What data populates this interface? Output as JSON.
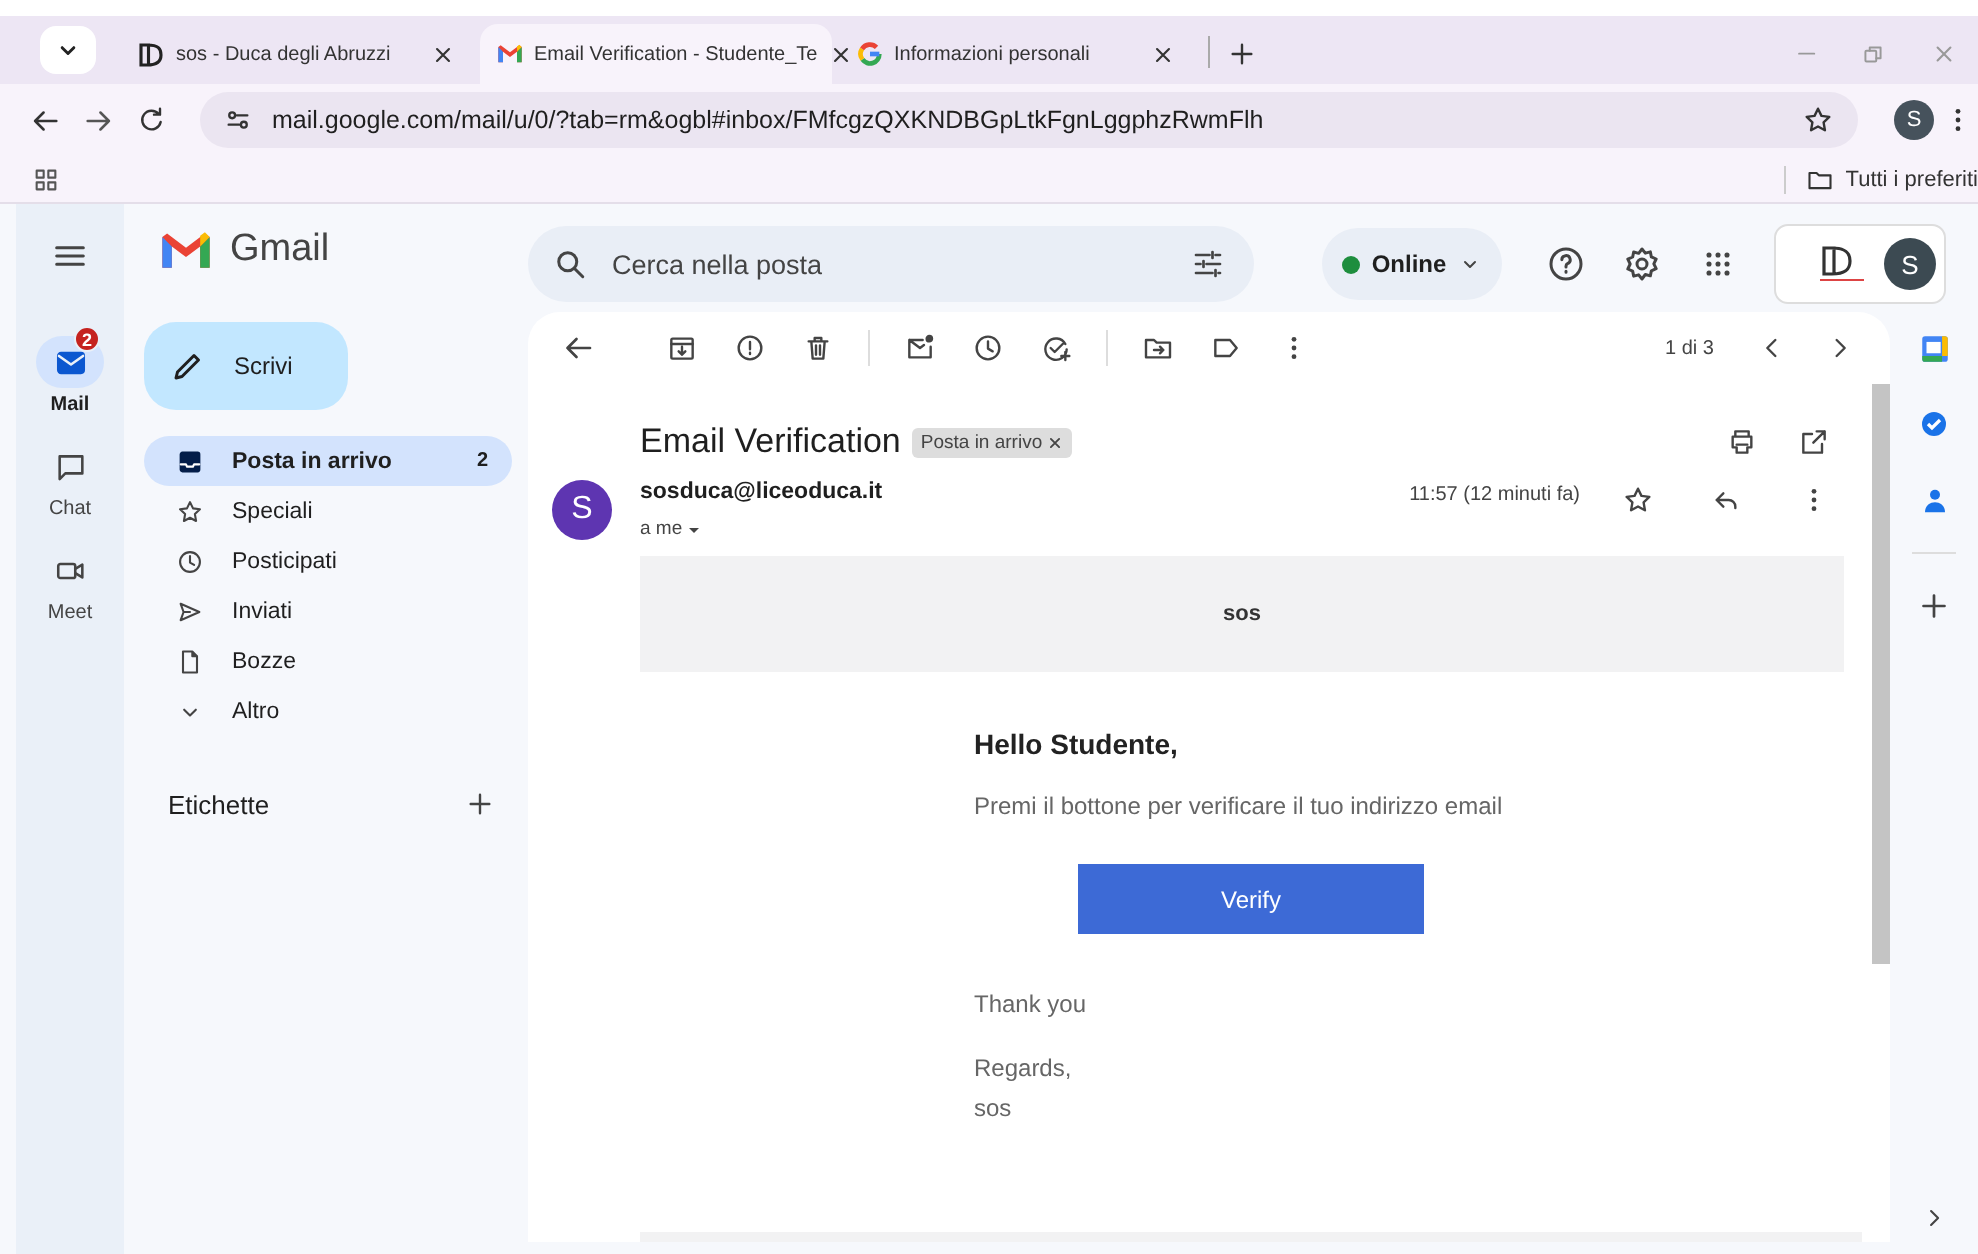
{
  "browser": {
    "tabs": [
      {
        "title": "sos - Duca degli Abruzzi",
        "selected": false
      },
      {
        "title": "Email Verification - Studente_Te",
        "selected": true
      },
      {
        "title": "Informazioni personali",
        "selected": false
      }
    ],
    "url": "mail.google.com/mail/u/0/?tab=rm&ogbl#inbox/FMfcgzQXKNDBGpLtkFgnLggphzRwmFlh",
    "profile_initial": "S",
    "bookmarks_folder": "Tutti i preferiti"
  },
  "rail": [
    {
      "label": "Mail",
      "badge": "2",
      "selected": true
    },
    {
      "label": "Chat",
      "selected": false
    },
    {
      "label": "Meet",
      "selected": false
    }
  ],
  "app_name": "Gmail",
  "compose": "Scrivi",
  "folders": [
    {
      "label": "Posta in arrivo",
      "count": "2",
      "selected": true
    },
    {
      "label": "Speciali",
      "selected": false
    },
    {
      "label": "Posticipati",
      "selected": false
    },
    {
      "label": "Inviati",
      "selected": false
    },
    {
      "label": "Bozze",
      "selected": false
    },
    {
      "label": "Altro",
      "selected": false
    }
  ],
  "labels_heading": "Etichette",
  "search": {
    "placeholder": "Cerca nella posta"
  },
  "status": {
    "label": "Online",
    "color": "#1e8e3e"
  },
  "account_initial": "S",
  "pagination": "1 di 3",
  "message": {
    "subject": "Email Verification",
    "label_chip": "Posta in arrivo",
    "sender_initial": "S",
    "sender": "sosduca@liceoduca.it",
    "recipient": "a me",
    "time": "11:57 (12 minuti fa)",
    "body": {
      "header": "sos",
      "greeting": "Hello Studente,",
      "text": "Premi il bottone per verificare il tuo indirizzo email",
      "button": "Verify",
      "thanks": "Thank you",
      "regards": "Regards,",
      "signature": "sos"
    }
  }
}
